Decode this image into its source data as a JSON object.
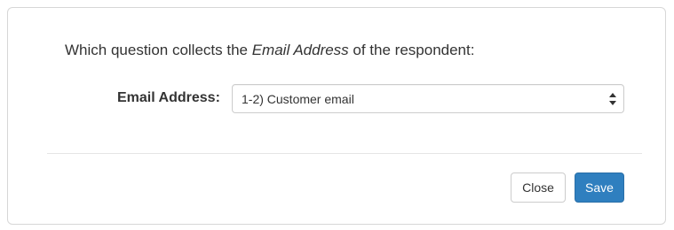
{
  "dialog": {
    "prompt": {
      "before": "Which question collects the ",
      "emphasis": "Email Address",
      "after": " of the respondent:"
    },
    "field": {
      "label": "Email Address:",
      "selected_value": "1-2) Customer email"
    },
    "buttons": {
      "close_label": "Close",
      "save_label": "Save"
    }
  },
  "colors": {
    "primary": "#2f7fbf",
    "text": "#333333",
    "border": "#cccccc"
  }
}
